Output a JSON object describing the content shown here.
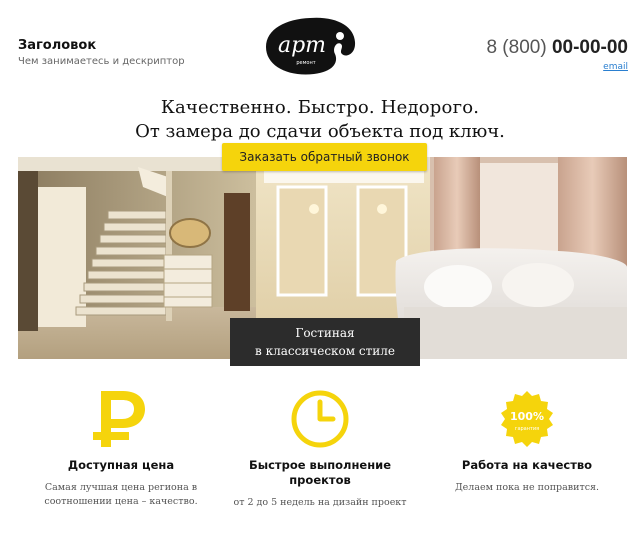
{
  "header": {
    "title": "Заголовок",
    "descriptor": "Чем занимаетесь и дескриптор",
    "logo_text": "арт",
    "logo_subtext": "ремонт",
    "phone_prefix": "8 (800)",
    "phone_number": "00-00-00",
    "email_label": "email"
  },
  "hero": {
    "headline_line1": "Качественно. Быстро. Недорого.",
    "headline_line2": "От замера до сдачи объекта под ключ.",
    "cta_label": "Заказать обратный звонок",
    "caption_line1": "Гостиная",
    "caption_line2": "в классическом стиле"
  },
  "features": [
    {
      "icon": "ruble-icon",
      "title": "Доступная цена",
      "text": "Самая лучшая цена региона в соотношении цена – качество."
    },
    {
      "icon": "clock-icon",
      "title": "Быстрое выполнение проектов",
      "text": "от 2 до 5 недель на дизайн проект"
    },
    {
      "icon": "quality-badge-icon",
      "badge_text": "100%",
      "badge_subtext": "гарантия",
      "title": "Работа на качество",
      "text": "Делаем пока не поправится."
    }
  ],
  "colors": {
    "accent": "#f5d40c",
    "link": "#2a7fd0",
    "caption_bg": "#2c2c2c"
  }
}
